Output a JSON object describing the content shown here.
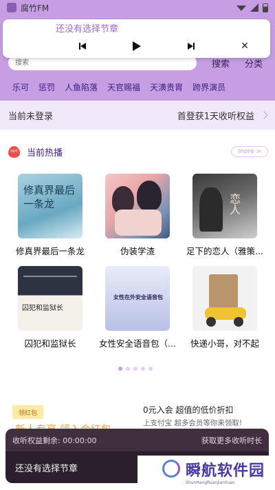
{
  "status_bar": {
    "app_name": "腐竹FM"
  },
  "mini_player": {
    "title": "还没有选择节章"
  },
  "search": {
    "placeholder": "搜索",
    "search_label": "搜索",
    "category_label": "分类"
  },
  "tags": [
    "乐可",
    "惩罚",
    "人鱼陷落",
    "天官赐福",
    "天潢贵胄",
    "跨界演员"
  ],
  "login_bar": {
    "status": "当前未登录",
    "offer": "首登获1天收听权益"
  },
  "hot_section": {
    "title": "当前热播",
    "more_label": "more >"
  },
  "works": [
    {
      "title": "修真界最后一条龙",
      "cover_text": "修真界最后一条龙"
    },
    {
      "title": "伪装学渣",
      "cover_text": ""
    },
    {
      "title": "足下的恋人（雅策...",
      "cover_text": "恋人"
    },
    {
      "title": "囚犯和监狱长",
      "cover_text": "囚犯和监狱长"
    },
    {
      "title": "女性安全语音包（...",
      "cover_text": "女性在外安全语音包"
    },
    {
      "title": "快递小哥，对不起",
      "cover_text": ""
    }
  ],
  "carousel": {
    "count": 5,
    "active_index": 0
  },
  "promo": {
    "badge": "领红包",
    "left_text": "新人专享 领入会红包",
    "right_title": "0元入会 超值的低价折扣",
    "right_sub": "上支付宝 超多会员等你来领取!"
  },
  "bottom_bar": {
    "left": "收听权益剩余: 00:00:00",
    "right": "获取更多收听时长"
  },
  "bottom_player": {
    "title": "还没有选择节章"
  },
  "watermark": {
    "title": "瞬航软件园",
    "subtitle": "ShunHangRuanJianYuan"
  },
  "colors": {
    "header": "#c79ee4",
    "accent": "#9b6bd6",
    "player_dark": "#2b1f2d"
  }
}
